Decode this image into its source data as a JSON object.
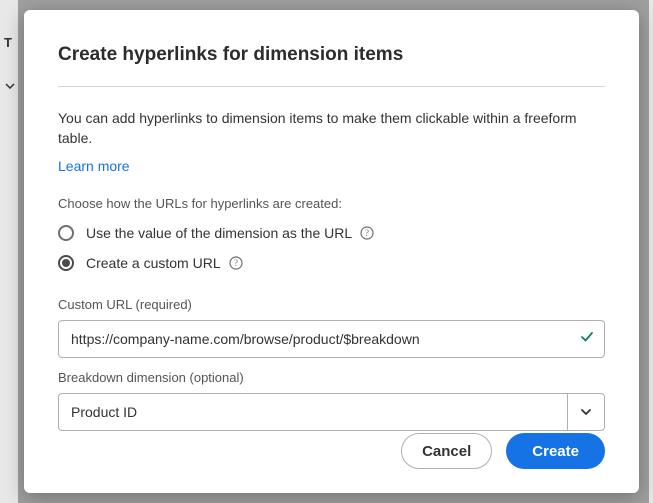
{
  "background": {
    "trunc_text": "T"
  },
  "dialog": {
    "title": "Create hyperlinks for dimension items",
    "intro": "You can add hyperlinks to dimension items to make them clickable within a freeform table.",
    "learn_more": "Learn more",
    "choose_label": "Choose how the URLs for hyperlinks are created:",
    "radio_options": [
      {
        "label": "Use the value of the dimension as the URL",
        "selected": false
      },
      {
        "label": "Create a custom URL",
        "selected": true
      }
    ],
    "custom_url": {
      "label": "Custom URL (required)",
      "value": "https://company-name.com/browse/product/$breakdown",
      "valid": true
    },
    "breakdown": {
      "label": "Breakdown dimension (optional)",
      "value": "Product ID"
    },
    "buttons": {
      "cancel": "Cancel",
      "create": "Create"
    }
  }
}
